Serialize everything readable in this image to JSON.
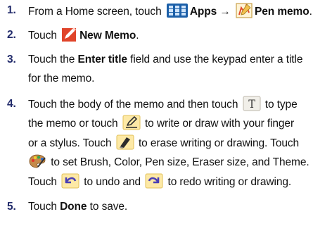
{
  "steps": [
    {
      "num": "1.",
      "lines": [
        [
          {
            "t": "From a Home screen, touch "
          },
          {
            "icon": "apps-grid-icon"
          },
          {
            "t": "Apps → ",
            "b": true
          },
          {
            "icon": "pen-memo-app-icon"
          },
          {
            "t": "Pen memo",
            "b": true
          },
          {
            "t": "."
          }
        ]
      ]
    },
    {
      "num": "2.",
      "lines": [
        [
          {
            "t": "Touch "
          },
          {
            "icon": "new-memo-icon"
          },
          {
            "t": "New Memo",
            "b": true
          },
          {
            "t": "."
          }
        ]
      ]
    },
    {
      "num": "3.",
      "lines": [
        [
          {
            "t": "Touch the "
          },
          {
            "t": "Enter title",
            "b": true
          },
          {
            "t": " field and use the keypad enter a title"
          }
        ],
        [
          {
            "t": "for the memo."
          }
        ]
      ]
    },
    {
      "num": "4.",
      "lines": [
        [
          {
            "t": "Touch the body of the memo and then touch "
          },
          {
            "icon": "text-mode-icon"
          },
          {
            "t": " to type"
          }
        ],
        [
          {
            "t": "the memo or touch "
          },
          {
            "icon": "pen-icon"
          },
          {
            "t": " to write or draw with your finger"
          }
        ],
        [
          {
            "t": "or a stylus. Touch "
          },
          {
            "icon": "eraser-icon"
          },
          {
            "t": " to erase writing or drawing. Touch"
          }
        ],
        [
          {
            "icon": "palette-icon"
          },
          {
            "t": " to set Brush, Color, Pen size, Eraser size, and Theme."
          }
        ],
        [
          {
            "t": "Touch "
          },
          {
            "icon": "undo-icon"
          },
          {
            "t": " to undo and "
          },
          {
            "icon": "redo-icon"
          },
          {
            "t": " to redo writing or drawing."
          }
        ]
      ]
    },
    {
      "num": "5.",
      "lines": [
        [
          {
            "t": "Touch "
          },
          {
            "t": "Done",
            "b": true
          },
          {
            "t": " to save."
          }
        ]
      ]
    }
  ]
}
